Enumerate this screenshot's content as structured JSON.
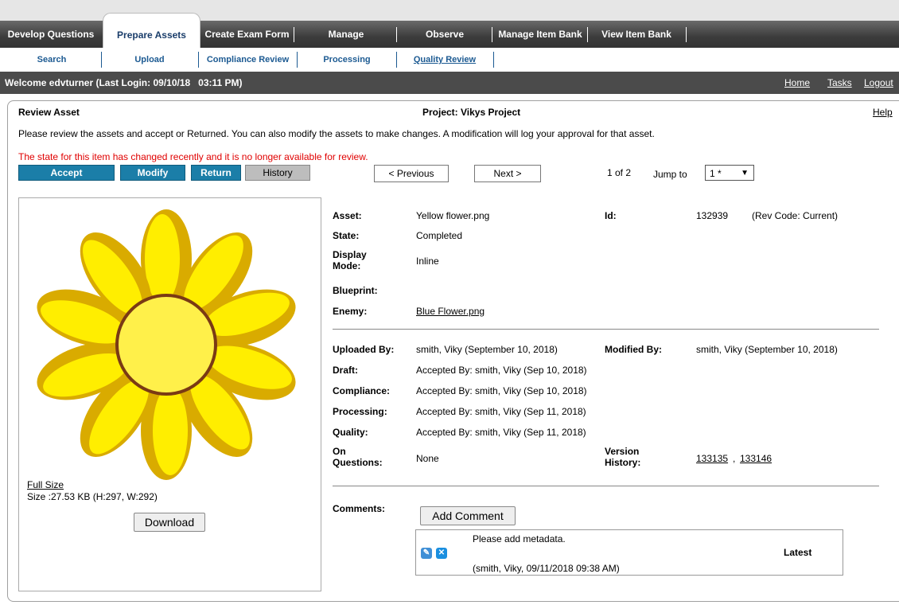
{
  "main_nav": {
    "tabs": [
      {
        "label": "Develop Questions"
      },
      {
        "label": "Prepare Assets"
      },
      {
        "label": "Create Exam Form"
      },
      {
        "label": "Manage"
      },
      {
        "label": "Observe"
      },
      {
        "label": "Manage Item Bank"
      },
      {
        "label": "View Item Bank"
      }
    ],
    "active_tab": "Prepare Assets"
  },
  "sub_nav": {
    "tabs": [
      {
        "label": "Search"
      },
      {
        "label": "Upload"
      },
      {
        "label": "Compliance Review"
      },
      {
        "label": "Processing"
      },
      {
        "label": "Quality Review"
      }
    ],
    "active_tab": "Quality Review"
  },
  "header": {
    "welcome": "Welcome edvturner (Last Login: 09/10/18   03:11 PM)",
    "links": {
      "home": "Home",
      "tasks": "Tasks",
      "logout": "Logout"
    }
  },
  "review": {
    "title": "Review Asset",
    "project": "Project: Vikys Project",
    "help": "Help",
    "instructions": "Please review the assets and accept or Returned. You can also modify the assets to make changes. A modification will log your approval for that asset.",
    "error": "The state for this item has changed recently and it is no longer available for review.",
    "buttons": {
      "accept": "Accept",
      "modify": "Modify",
      "return": "Return",
      "history": "History",
      "previous": "< Previous",
      "next": "Next >"
    },
    "pager": {
      "position": "1 of 2",
      "jump_label": "Jump to",
      "jump_value": "1 *"
    }
  },
  "preview": {
    "full_size": "Full Size",
    "size_info": "Size :27.53 KB (H:297, W:292)",
    "download": "Download"
  },
  "details": {
    "asset_label": "Asset:",
    "asset_value": "Yellow flower.png",
    "id_label": "Id:",
    "id_value": "132939",
    "rev_code": "(Rev Code: Current)",
    "state_label": "State:",
    "state_value": "Completed",
    "display_mode_label_1": "Display",
    "display_mode_label_2": "Mode:",
    "display_mode_value": "Inline",
    "blueprint_label": "Blueprint:",
    "enemy_label": "Enemy:",
    "enemy_value": "Blue Flower.png",
    "uploaded_by_label": "Uploaded By:",
    "uploaded_by_value": "smith, Viky (September 10, 2018)",
    "modified_by_label": "Modified By:",
    "modified_by_value": "smith, Viky (September 10, 2018)",
    "draft_label": "Draft:",
    "draft_value": "Accepted By: smith, Viky (Sep 10, 2018)",
    "compliance_label": "Compliance:",
    "compliance_value": "Accepted By: smith, Viky (Sep 10, 2018)",
    "processing_label": "Processing:",
    "processing_value": "Accepted By: smith, Viky (Sep 11, 2018)",
    "quality_label": "Quality:",
    "quality_value": "Accepted By: smith, Viky (Sep 11, 2018)",
    "on_questions_label_1": "On",
    "on_questions_label_2": "Questions:",
    "on_questions_value": "None",
    "version_history_label_1": "Version",
    "version_history_label_2": "History:",
    "version_1": "133135",
    "version_sep": ",",
    "version_2": "133146"
  },
  "comments": {
    "label": "Comments:",
    "add_button": "Add Comment",
    "items": [
      {
        "text": "Please add metadata.",
        "meta": "(smith, Viky, 09/11/2018 09:38 AM)",
        "tag": "Latest"
      }
    ]
  },
  "colors": {
    "nav_dark": "#3c3c3c",
    "accent_blue": "#1b7ea8",
    "link_blue": "#1c5a92",
    "error_red": "#e00000",
    "petal_outer": "#d9ab00",
    "petal_inner": "#ffee00",
    "center": "#fff04a"
  }
}
